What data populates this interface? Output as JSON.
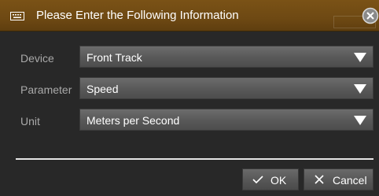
{
  "dialog": {
    "title": "Please Enter the Following Information",
    "icons": {
      "title": "keyboard-icon",
      "close": "close-icon"
    }
  },
  "fields": [
    {
      "label": "Device",
      "value": "Front Track"
    },
    {
      "label": "Parameter",
      "value": "Speed"
    },
    {
      "label": "Unit",
      "value": "Meters per Second"
    }
  ],
  "buttons": {
    "ok": "OK",
    "cancel": "Cancel"
  },
  "colors": {
    "titlebar": "#6e4913",
    "body": "#282828",
    "select": "#5a5a5a",
    "label": "#a9a9a9",
    "text": "#ffffff"
  }
}
